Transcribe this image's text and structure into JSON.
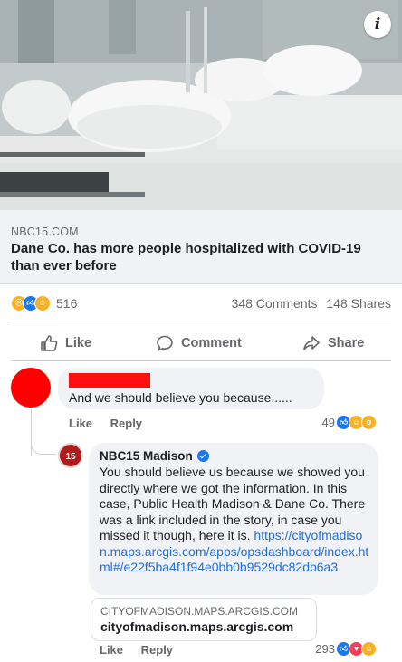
{
  "hero": {
    "info_icon": "info-icon",
    "info_label": "i"
  },
  "link": {
    "domain": "NBC15.COM",
    "title": "Dane Co. has more people hospitalized with COVID-19 than ever before"
  },
  "summary": {
    "reactions": [
      "sad",
      "like",
      "care"
    ],
    "reaction_count": "516",
    "comments": "348 Comments",
    "shares": "148 Shares"
  },
  "actions": {
    "like": "Like",
    "comment": "Comment",
    "share": "Share"
  },
  "comment1": {
    "text": "And we should believe you because......",
    "like": "Like",
    "reply": "Reply",
    "reaction_count": "49",
    "reactions": [
      "like",
      "haha",
      "wow"
    ]
  },
  "comment2": {
    "name": "NBC15 Madison",
    "avatar_text": "15",
    "body": "You should believe us because we showed you directly where we got the information. In this case, Public Health Madison & Dane Co. There was a link included in the story, in case you missed it though, here it is.",
    "link": "https://cityofmadison.maps.arcgis.com/apps/opsdashboard/index.html#/e22f5ba4f1f94e0bb0b9529dc82db6a3",
    "preview_domain": "CITYOFMADISON.MAPS.ARCGIS.COM",
    "preview_title": "cityofmadison.maps.arcgis.com",
    "like": "Like",
    "reply": "Reply",
    "reaction_count": "293",
    "reactions": [
      "like",
      "love",
      "haha"
    ]
  },
  "colors": {
    "accent": "#1877f2",
    "link": "#216fdb",
    "redaction": "#fe0000",
    "bubble": "#f0f2f5"
  }
}
